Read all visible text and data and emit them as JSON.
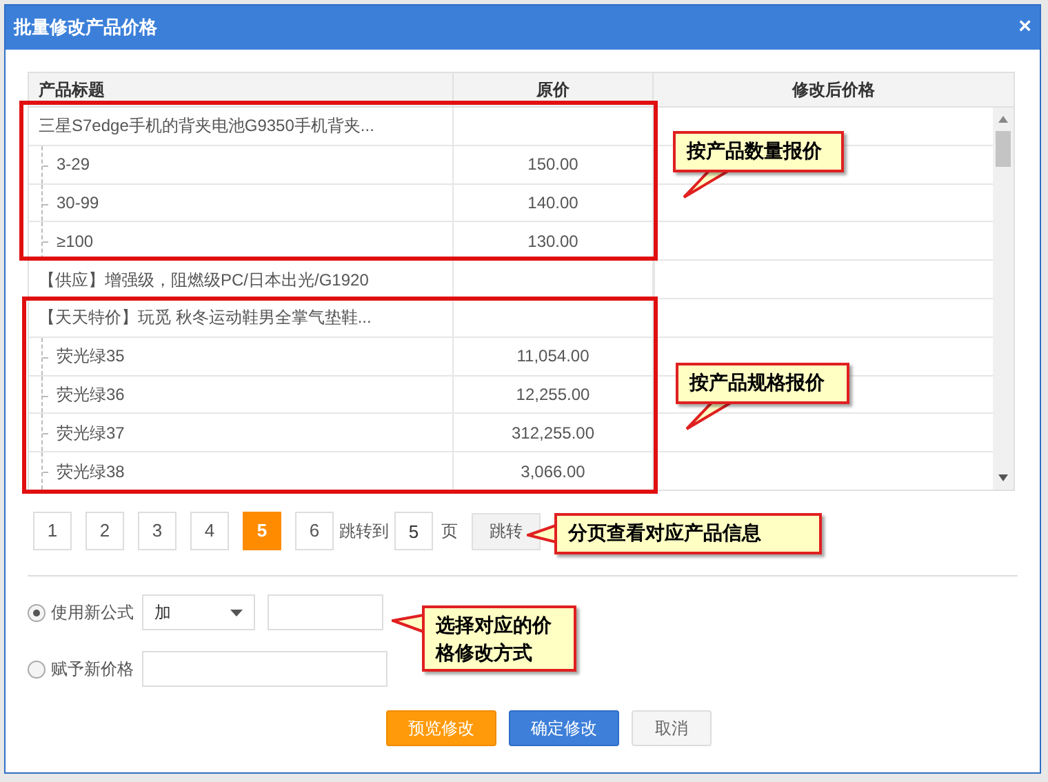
{
  "dialog": {
    "title": "批量修改产品价格",
    "close": "×"
  },
  "table": {
    "columns": [
      "产品标题",
      "原价",
      "修改后价格"
    ],
    "products": [
      {
        "title": "三星S7edge手机的背夹电池G9350手机背夹...",
        "children": [
          {
            "label": "3-29",
            "price": "150.00"
          },
          {
            "label": "30-99",
            "price": "140.00"
          },
          {
            "label": "≥100",
            "price": "130.00"
          }
        ]
      },
      {
        "title": "【供应】增强级，阻燃级PC/日本出光/G1920"
      },
      {
        "title": "【天天特价】玩觅 秋冬运动鞋男全掌气垫鞋...",
        "children": [
          {
            "label": "荧光绿35",
            "price": "11,054.00"
          },
          {
            "label": "荧光绿36",
            "price": "12,255.00"
          },
          {
            "label": "荧光绿37",
            "price": "312,255.00"
          },
          {
            "label": "荧光绿38",
            "price": "3,066.00"
          }
        ]
      }
    ]
  },
  "pagination": {
    "pages": [
      {
        "label": "1",
        "selected": false
      },
      {
        "label": "2",
        "selected": false
      },
      {
        "label": "3",
        "selected": false
      },
      {
        "label": "4",
        "selected": false
      },
      {
        "label": "5",
        "selected": true
      },
      {
        "label": "6",
        "selected": false
      }
    ],
    "jump_label": "跳转到",
    "jump_value": "5",
    "page_unit": "页",
    "jump_button": "跳转"
  },
  "options": [
    {
      "kind": "formula",
      "label": "使用新公式",
      "selected": true,
      "operator": "加"
    },
    {
      "kind": "price",
      "label": "赋予新价格",
      "selected": false
    }
  ],
  "buttons": [
    {
      "kind": "preview",
      "label": "预览修改"
    },
    {
      "kind": "confirm",
      "label": "确定修改"
    },
    {
      "kind": "cancel",
      "label": "取消"
    }
  ],
  "annotations": [
    "按产品数量报价",
    "按产品规格报价",
    "分页查看对应产品信息",
    "选择对应的价格修改方式"
  ]
}
